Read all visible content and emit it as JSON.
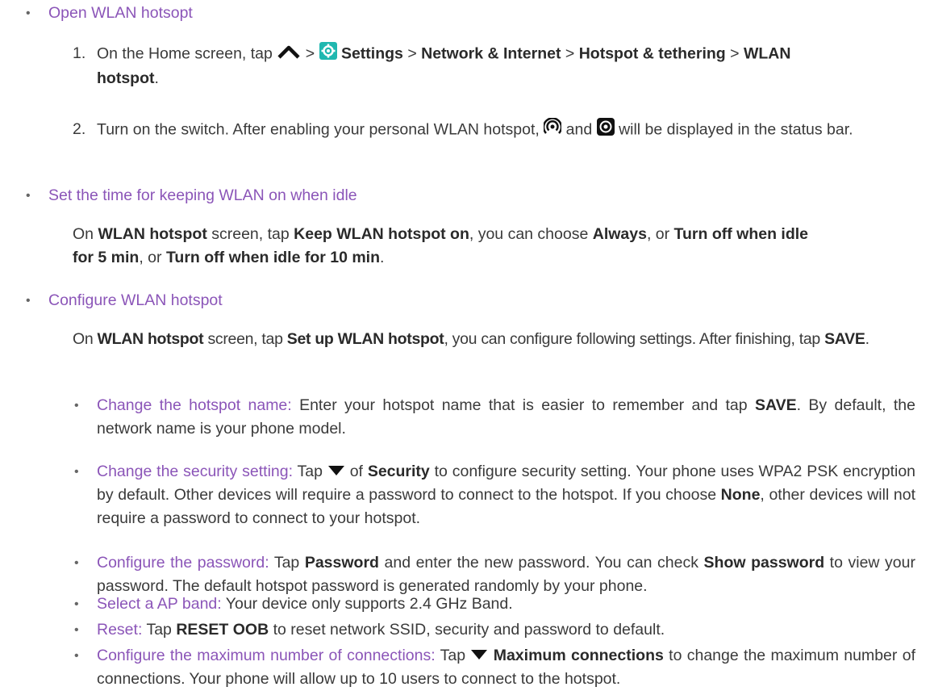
{
  "b1": "Open WLAN hotsopt",
  "s1": {
    "n": "1.",
    "t1": "On the Home screen, tap",
    "gt": ">",
    "settings": "Settings",
    "network": "Network & Internet",
    "hotspot_tethering": "Hotspot & tethering",
    "wlan": "WLAN",
    "hotspot": "hotspot",
    "period": "."
  },
  "s2": {
    "n": "2.",
    "t1": "Turn on the switch. After enabling your personal WLAN hotspot,",
    "and": "and",
    "t2": "will be displayed in the status bar."
  },
  "b2": "Set the time for keeping WLAN on when idle",
  "p2": {
    "on": "On",
    "wlan_hotspot": "WLAN hotspot",
    "screen_tap": "screen, tap",
    "keep": "Keep WLAN hotspot on",
    "choose": ", you can choose",
    "always": "Always",
    "or1": ", or",
    "off5a": "Turn off when idle",
    "off5b": "for 5 min",
    "or2": ", or",
    "off10": "Turn off when idle for 10 min",
    "period": "."
  },
  "b3": "Configure WLAN hotspot",
  "p3": {
    "on": "On",
    "wlan_hotspot": "WLAN hotspot",
    "screen_tap": "screen, tap",
    "setup": "Set up WLAN hotspot",
    "rest": ", you can configure following settings. After finishing, tap",
    "save": "SAVE",
    "period": "."
  },
  "i1": {
    "link": "Change the hotspot name:",
    "t1": "Enter your hotspot name that is easier to remember and tap",
    "save": "SAVE",
    "t2": ". By default, the network name is your phone model."
  },
  "i2": {
    "link": "Change the security setting:",
    "tap": "Tap",
    "of": "of",
    "security": "Security",
    "t1": "to configure security setting. Your phone uses WPA2 PSK encryption by default. Other devices will require a password to connect to the hotspot. If you choose",
    "none": "None",
    "t2": ", other devices will not require a password to connect to your hotspot."
  },
  "i3": {
    "link": "Configure the password:",
    "tap": "Tap",
    "password": "Password",
    "t1": "and enter the new password. You can check",
    "show": "Show password",
    "t2": "to view your password. The default hotspot password is generated randomly by your phone."
  },
  "i4": {
    "link": "Select a AP band:",
    "t1": "Your device only supports 2.4 GHz Band."
  },
  "i5": {
    "link": "Reset:",
    "tap": "Tap",
    "reset": "RESET OOB",
    "t1": "to reset network SSID, security and password to default."
  },
  "i6": {
    "link": "Configure the maximum number of connections:",
    "tap": "Tap",
    "max": "Maximum connections",
    "t1": "to change the maximum number of connections. Your phone will allow up to 10 users to connect to the hotspot."
  },
  "bullet_glyph": "•",
  "colors": {
    "link": "#8b55b8",
    "settings_icon": "#20b8b0"
  }
}
